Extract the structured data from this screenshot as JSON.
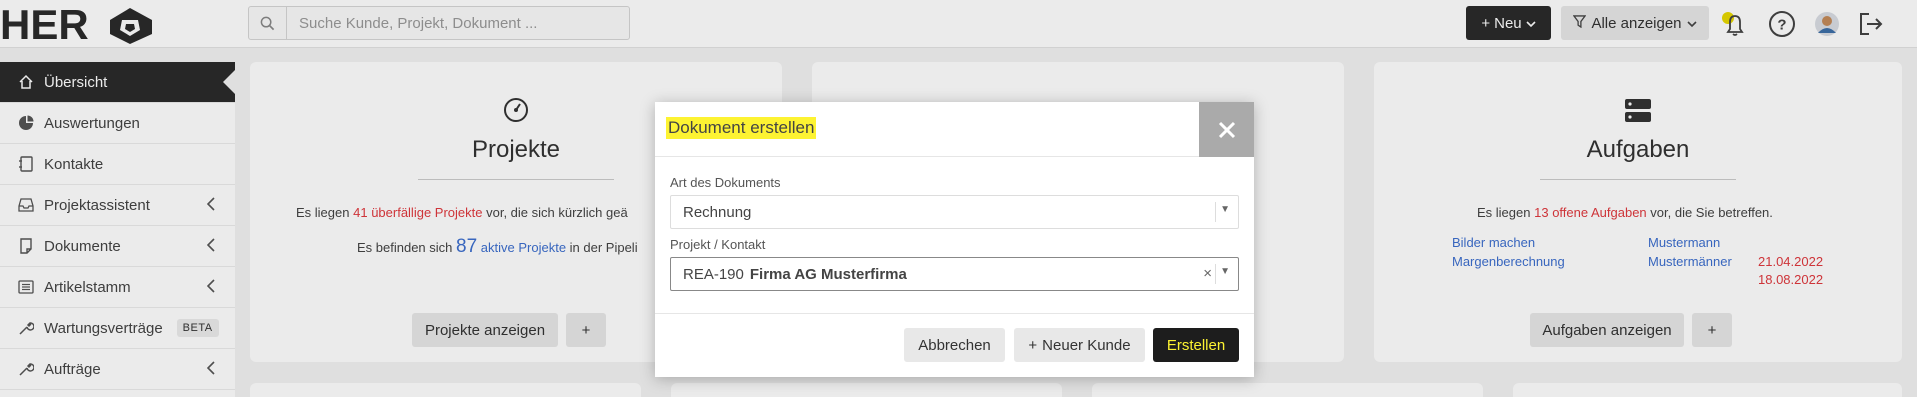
{
  "app": {
    "logo_text": "HERO"
  },
  "topbar": {
    "search_placeholder": "Suche Kunde, Projekt, Dokument ...",
    "new_label": "Neu",
    "filter_label": "Alle anzeigen",
    "icons": [
      "bell-icon",
      "help-icon",
      "avatar",
      "logout-icon"
    ]
  },
  "sidebar": {
    "items": [
      {
        "label": "Übersicht",
        "icon": "home-icon",
        "active": true
      },
      {
        "label": "Auswertungen",
        "icon": "pie-chart-icon"
      },
      {
        "label": "Kontakte",
        "icon": "address-book-icon"
      },
      {
        "label": "Projektassistent",
        "icon": "inbox-icon",
        "chevron": true
      },
      {
        "label": "Dokumente",
        "icon": "document-icon",
        "chevron": true
      },
      {
        "label": "Artikelstamm",
        "icon": "list-icon",
        "chevron": true
      },
      {
        "label": "Wartungsverträge",
        "icon": "wrench-icon",
        "badge": "BETA"
      },
      {
        "label": "Aufträge",
        "icon": "wrench-icon",
        "chevron": true
      }
    ]
  },
  "cards": {
    "projekte": {
      "title": "Projekte",
      "line1_pre": "Es liegen ",
      "line1_count": "41",
      "line1_link": "überfällige Projekte",
      "line1_post": " vor, die sich kürzlich geä",
      "line2_pre": "Es befinden sich ",
      "line2_count": "87",
      "line2_link": "aktive Projekte",
      "line2_post": " in der Pipeli",
      "show_button": "Projekte anzeigen",
      "add_button": "+"
    },
    "aufgaben": {
      "title": "Aufgaben",
      "line1_pre": "Es liegen ",
      "line1_count": "13",
      "line1_link": "offene Aufgaben",
      "line1_post": " vor, die Sie betreffen.",
      "tasks": [
        {
          "name": "Bilder machen",
          "assignee": "Mustermann",
          "date": ""
        },
        {
          "name": "Margenberechnung",
          "assignee": "Mustermänner",
          "date": "21.04.2022"
        },
        {
          "name": "",
          "assignee": "",
          "date": "18.08.2022"
        }
      ],
      "show_button": "Aufgaben anzeigen",
      "add_button": "+"
    }
  },
  "modal": {
    "title": "Dokument erstellen",
    "field1_label": "Art des Dokuments",
    "field1_value": "Rechnung",
    "field2_label": "Projekt / Kontakt",
    "field2_code": "REA-190",
    "field2_name": "Firma AG Musterfirma",
    "cancel_label": "Abbrechen",
    "new_customer_label": "Neuer Kunde",
    "create_label": "Erstellen"
  },
  "colors": {
    "highlight_yellow": "#fdf332",
    "dark": "#1d1d1d",
    "red": "#e0393e",
    "blue": "#3d6fcf"
  }
}
